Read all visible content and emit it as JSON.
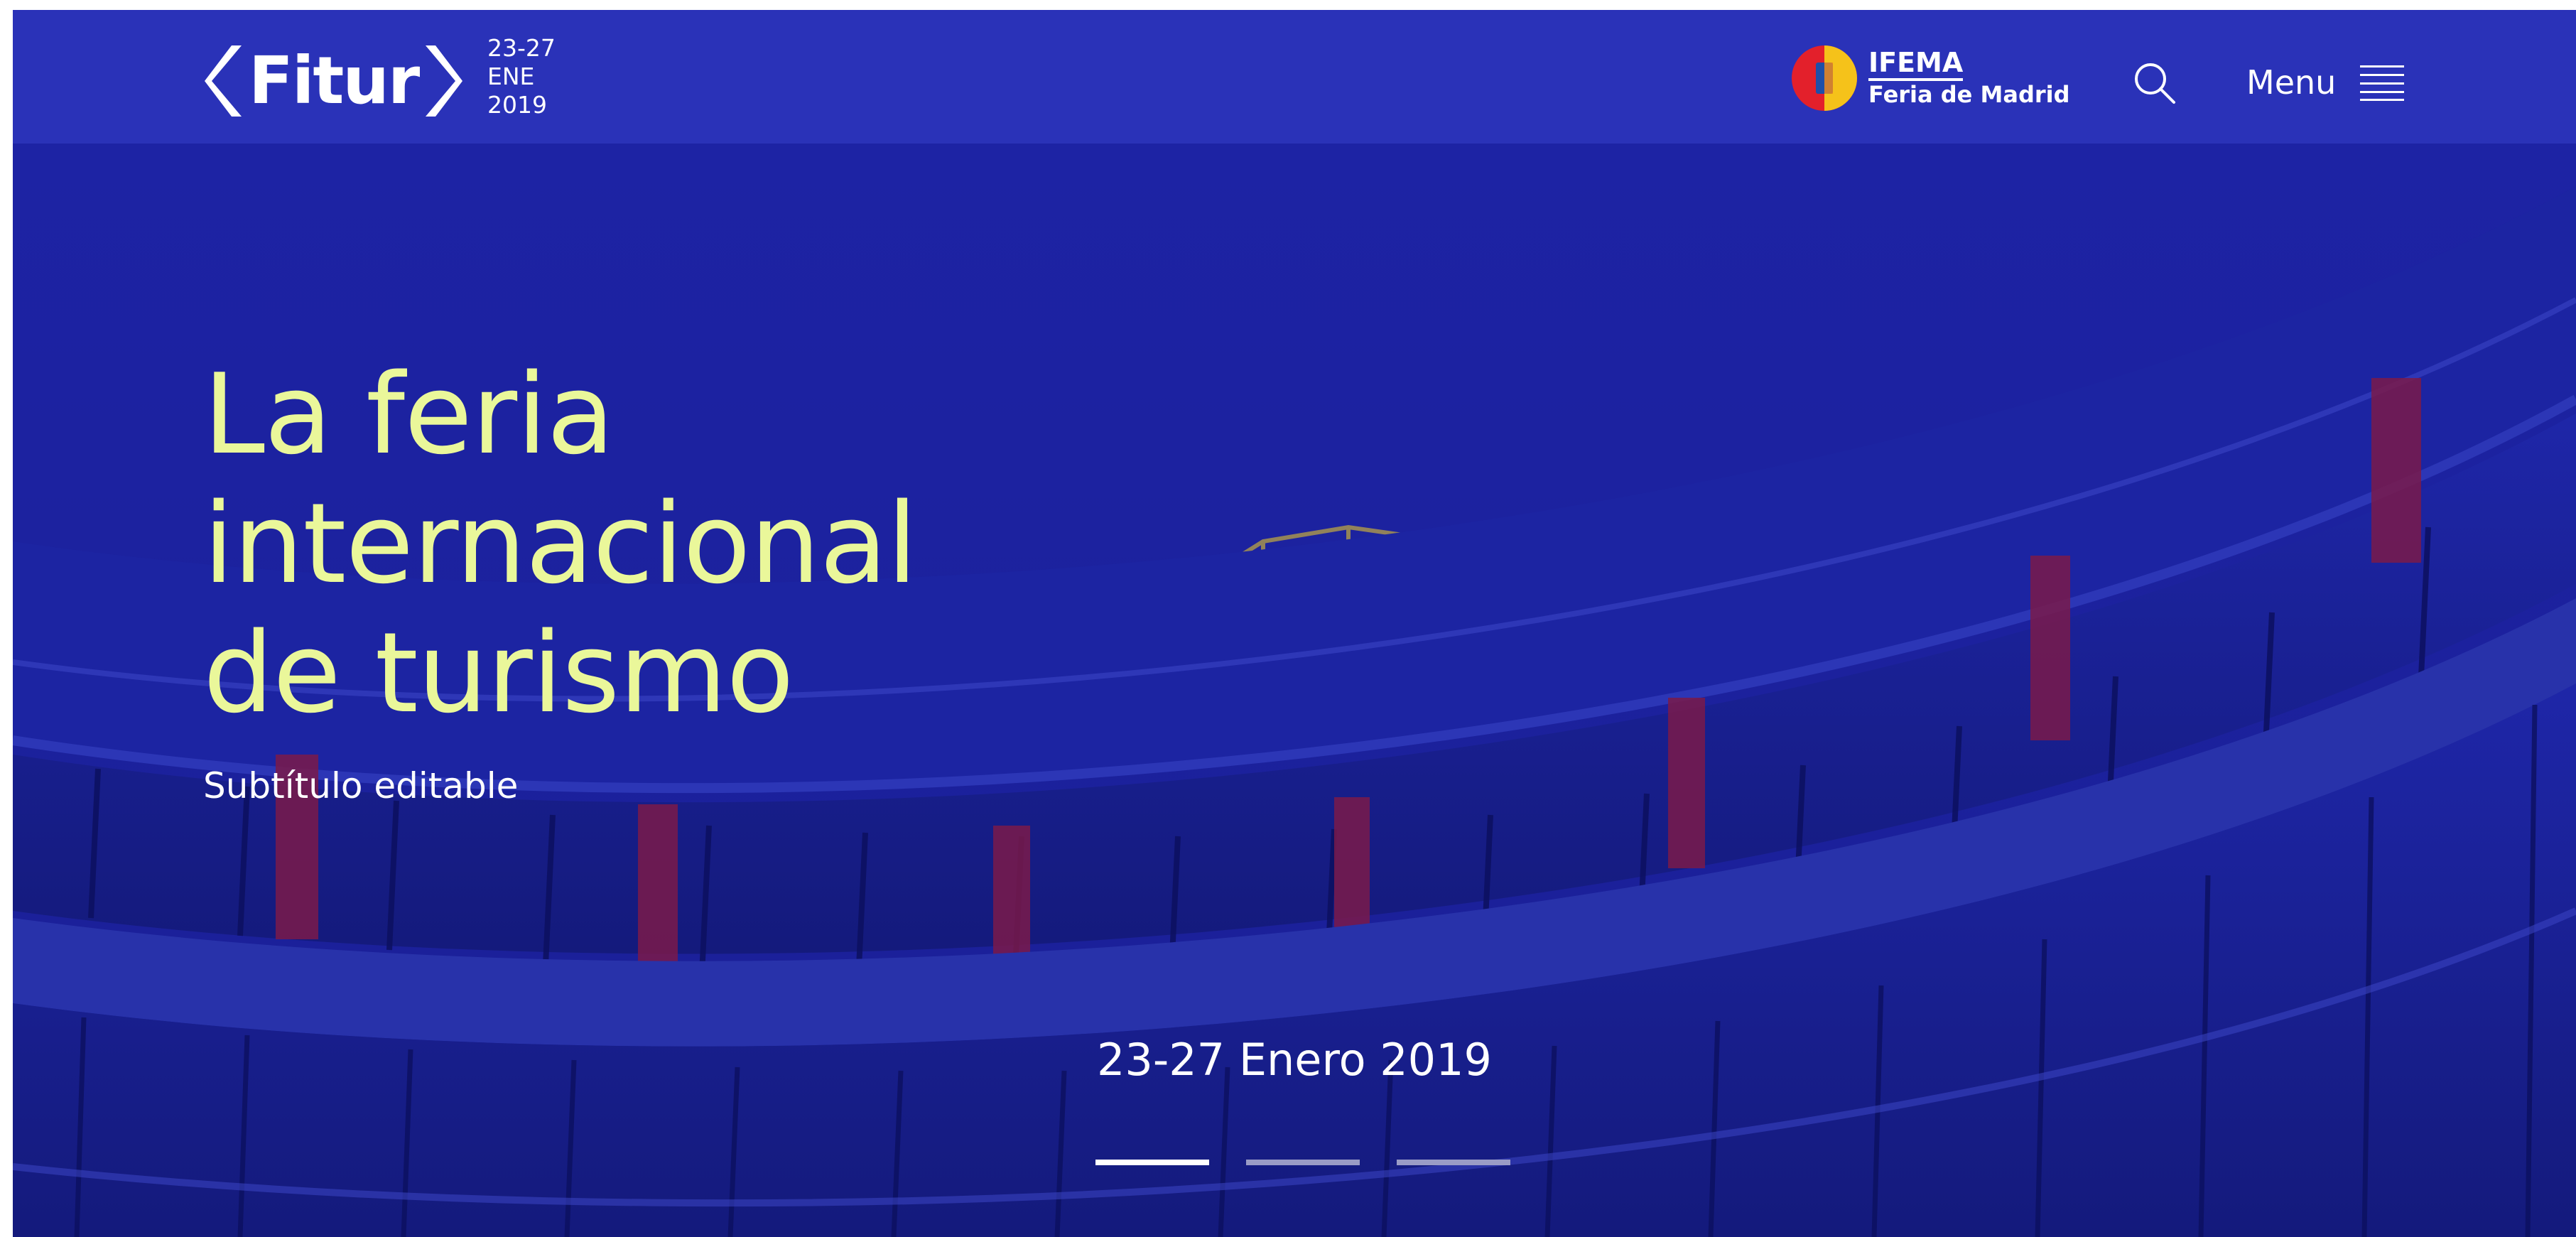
{
  "header": {
    "logo_text": "Fitur",
    "dates": [
      "23-27",
      "ENE",
      "2019"
    ],
    "partner": {
      "title": "IFEMA",
      "subtitle": "Feria de Madrid"
    },
    "search_icon": "search-icon",
    "menu_label": "Menu",
    "menu_icon": "hamburger-icon"
  },
  "hero": {
    "headline_lines": [
      "La feria",
      "internacional",
      "de turismo"
    ],
    "subtitle": "Subtítulo editable",
    "event_date": "23-27 Enero 2019",
    "slides_total": 3,
    "active_slide": 1
  },
  "colors": {
    "header_bg": "#2a32b8",
    "hero_overlay": "#1a1f99",
    "headline": "#eaf79a",
    "text": "#ffffff",
    "ifema_red": "#e3202b",
    "ifema_yellow": "#f5c21a",
    "ifema_blue": "#1f4fa8"
  }
}
